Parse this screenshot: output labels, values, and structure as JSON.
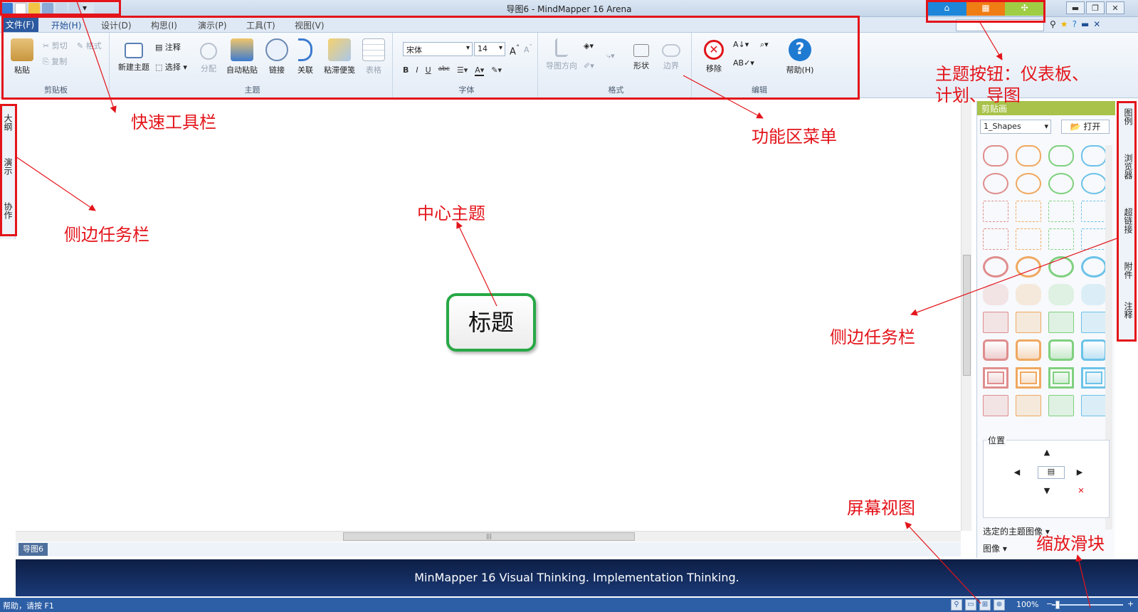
{
  "window": {
    "title": "导图6 - MindMapper 16 Arena",
    "theme_buttons": [
      {
        "name": "dashboard",
        "color": "#1e86d9",
        "icon": "home-icon"
      },
      {
        "name": "plan",
        "color": "#f07d14",
        "icon": "calendar-icon"
      },
      {
        "name": "map",
        "color": "#9fce45",
        "icon": "mindmap-icon"
      }
    ],
    "controls": [
      "▬",
      "❐",
      "✕"
    ]
  },
  "menu": {
    "tabs": [
      "文件(F)",
      "开始(H)",
      "设计(D)",
      "构思(I)",
      "演示(P)",
      "工具(T)",
      "视图(V)"
    ]
  },
  "ribbon": {
    "groups": {
      "clipboard": "剪贴板",
      "topic": "主题",
      "font": "字体",
      "format": "格式",
      "edit": "编辑"
    },
    "clipboard": {
      "paste": "粘贴",
      "cut": "剪切",
      "copy": "复制",
      "format_painter": "格式"
    },
    "topic": {
      "new_topic": "新建主题",
      "note": "注释",
      "select": "选择",
      "split": "分配",
      "auto_paste": "自动粘贴",
      "link": "链接",
      "relate": "关联",
      "sticky": "粘滞便笺",
      "table": "表格"
    },
    "font": {
      "family": "宋体",
      "size": "14",
      "bold": "B",
      "italic": "I",
      "underline": "U",
      "strike": "abc"
    },
    "format": {
      "direction": "导图方向",
      "shape": "形状",
      "boundary": "边界"
    },
    "edit": {
      "remove": "移除",
      "help": "帮助(H)"
    }
  },
  "left_sidebar": {
    "tabs": [
      "大纲",
      "演示",
      "协作"
    ]
  },
  "canvas": {
    "center_topic": "标题"
  },
  "doc_tab": "导图6",
  "banner": "MinMapper 16 Visual Thinking. Implementation Thinking.",
  "status": {
    "help": "帮助，请按 F1",
    "zoom": "100%"
  },
  "right_panel": {
    "title": "剪贴画",
    "category": "1_Shapes",
    "open": "打开",
    "position_label": "位置",
    "selected_image": "选定的主题图像",
    "image": "图像",
    "shape_colors": [
      "#e08d8d",
      "#f0a860",
      "#7fd07f",
      "#6cc2e8"
    ]
  },
  "right_sidebar": {
    "tabs": [
      "图例",
      "浏览器",
      "超链接",
      "附件",
      "注释"
    ]
  },
  "annotations": {
    "quick_toolbar": "快速工具栏",
    "ribbon_menu": "功能区菜单",
    "theme_buttons_line1": "主题按钮：仪表板、",
    "theme_buttons_line2": "计划、导图",
    "left_taskbar": "侧边任务栏",
    "center_topic": "中心主题",
    "right_taskbar": "侧边任务栏",
    "screen_view": "屏幕视图",
    "zoom_slider": "缩放滑块",
    "color": "#e3141a"
  }
}
